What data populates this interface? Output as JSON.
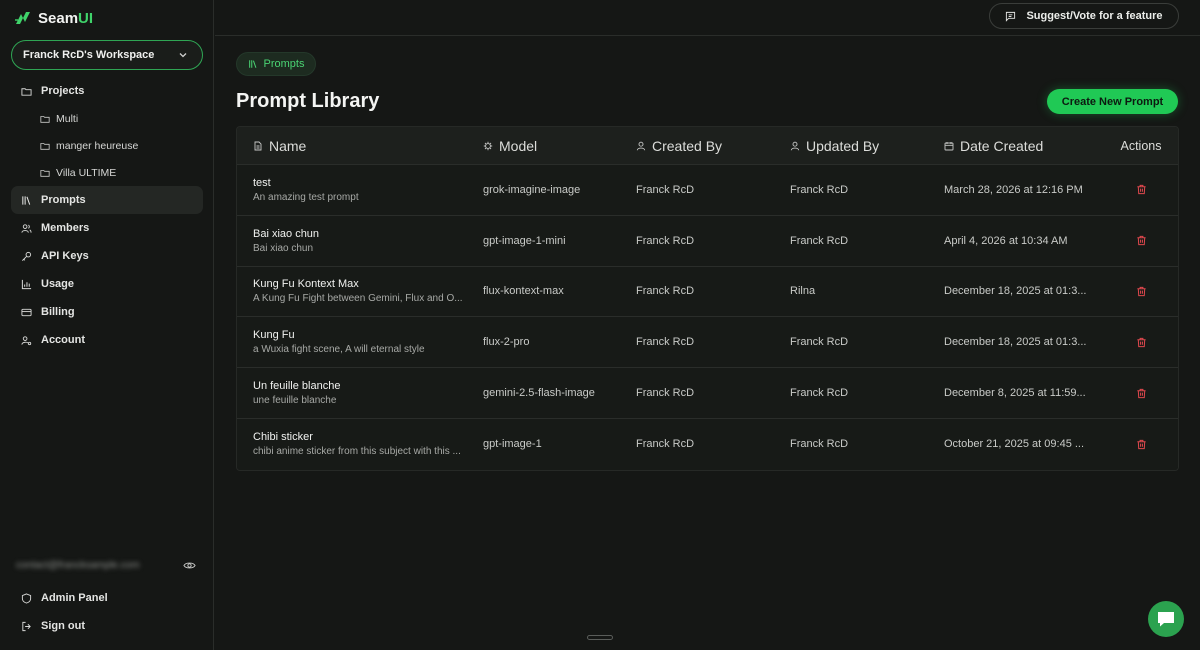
{
  "app": {
    "name_prefix": "Seam",
    "name_accent": "UI",
    "accent_color": "#20c955"
  },
  "sidebar": {
    "workspace": "Franck RcD's Workspace",
    "items": [
      {
        "label": "Projects",
        "icon": "folder-icon"
      },
      {
        "label": "Multi",
        "icon": "folder-icon"
      },
      {
        "label": "manger heureuse",
        "icon": "folder-icon"
      },
      {
        "label": "Villa ULTIME",
        "icon": "folder-icon"
      },
      {
        "label": "Prompts",
        "icon": "book-icon"
      },
      {
        "label": "Members",
        "icon": "users-icon"
      },
      {
        "label": "API Keys",
        "icon": "key-icon"
      },
      {
        "label": "Usage",
        "icon": "bar-chart-icon"
      },
      {
        "label": "Billing",
        "icon": "credit-card-icon"
      },
      {
        "label": "Account",
        "icon": "user-cog-icon"
      }
    ],
    "email": "contact@francksample.com",
    "bottom": [
      {
        "label": "Admin Panel",
        "icon": "shield-icon"
      },
      {
        "label": "Sign out",
        "icon": "logout-icon"
      }
    ]
  },
  "topbar": {
    "suggest_label": "Suggest/Vote for a feature"
  },
  "main": {
    "breadcrumb": "Prompts",
    "title": "Prompt Library",
    "create_label": "Create New Prompt",
    "columns": {
      "name": "Name",
      "model": "Model",
      "created_by": "Created By",
      "updated_by": "Updated By",
      "date_created": "Date Created",
      "actions": "Actions"
    },
    "rows": [
      {
        "name": "test",
        "desc": "An amazing test prompt",
        "model": "grok-imagine-image",
        "created_by": "Franck RcD",
        "updated_by": "Franck RcD",
        "date": "March 28, 2026 at 12:16 PM"
      },
      {
        "name": "Bai xiao chun",
        "desc": "Bai xiao chun",
        "model": "gpt-image-1-mini",
        "created_by": "Franck RcD",
        "updated_by": "Franck RcD",
        "date": "April 4, 2026 at 10:34 AM"
      },
      {
        "name": "Kung Fu Kontext Max",
        "desc": "A Kung Fu Fight between Gemini, Flux and O...",
        "model": "flux-kontext-max",
        "created_by": "Franck RcD",
        "updated_by": "Rilna",
        "date": "December 18, 2025 at 01:3..."
      },
      {
        "name": "Kung Fu",
        "desc": "a Wuxia fight scene, A will eternal style",
        "model": "flux-2-pro",
        "created_by": "Franck RcD",
        "updated_by": "Franck RcD",
        "date": "December 18, 2025 at 01:3..."
      },
      {
        "name": "Un feuille blanche",
        "desc": "une feuille blanche",
        "model": "gemini-2.5-flash-image",
        "created_by": "Franck RcD",
        "updated_by": "Franck RcD",
        "date": "December 8, 2025 at 11:59..."
      },
      {
        "name": "Chibi sticker",
        "desc": "chibi anime sticker from this subject with this ...",
        "model": "gpt-image-1",
        "created_by": "Franck RcD",
        "updated_by": "Franck RcD",
        "date": "October 21, 2025 at 09:45 ..."
      }
    ]
  }
}
